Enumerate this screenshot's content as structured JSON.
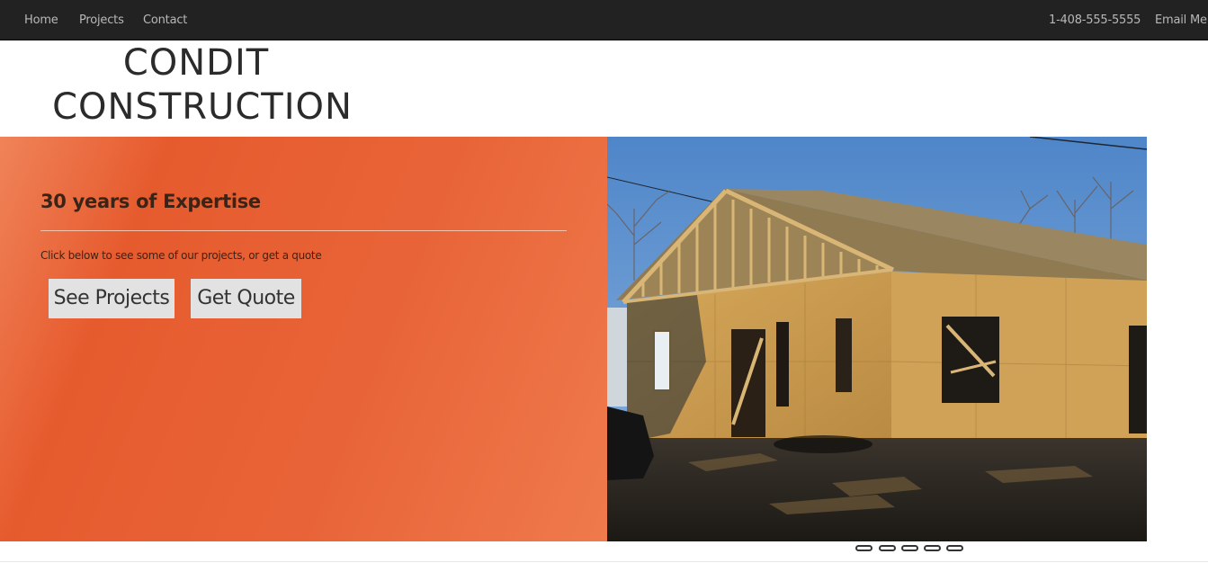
{
  "nav": {
    "left_links": [
      "Home",
      "Projects",
      "Contact"
    ],
    "phone": "1-408-555-5555",
    "email_label": "Email Me"
  },
  "brand": {
    "line1": "CONDIT",
    "line2": "CONSTRUCTION"
  },
  "hero": {
    "title": "30 years of Expertise",
    "subtitle": "Click below to see some of our projects, or get a quote",
    "see_projects_label": "See Projects",
    "get_quote_label": "Get Quote"
  },
  "carousel": {
    "slide_count": 5
  },
  "colors": {
    "navbar_bg": "#222222",
    "hero_accent": "#e8622f",
    "button_bg": "#e2e2e2"
  }
}
